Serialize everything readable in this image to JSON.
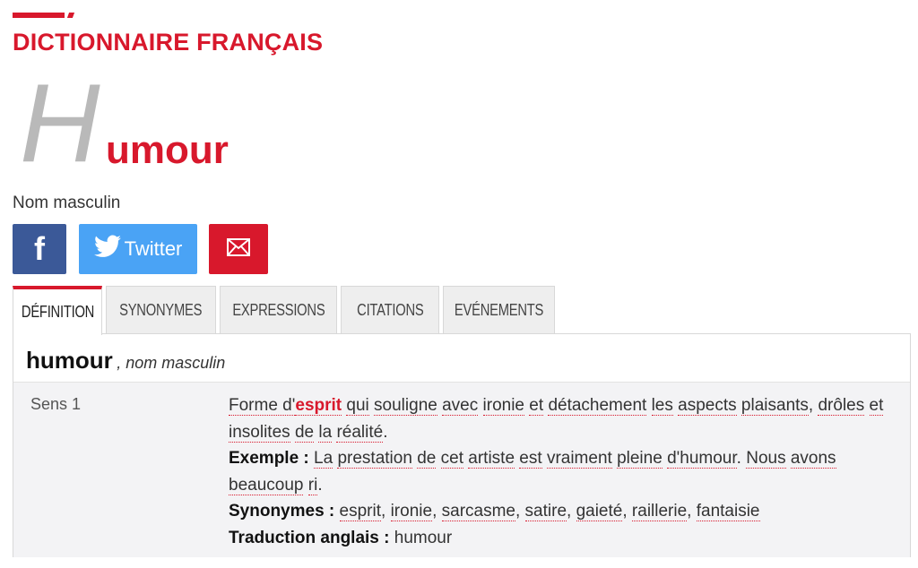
{
  "site": {
    "title": "DICTIONNAIRE FRANÇAIS"
  },
  "headword": {
    "first_letter": "H",
    "rest": "umour"
  },
  "grammar": "Nom masculin",
  "share": {
    "facebook_icon": "facebook-icon",
    "twitter_label": "Twitter",
    "twitter_icon": "twitter-bird-icon",
    "email_icon": "envelope-icon",
    "colors": {
      "facebook": "#3b5998",
      "twitter": "#4aa3f5",
      "email": "#d8182c"
    }
  },
  "tabs": [
    {
      "label": "DÉFINITION",
      "active": true
    },
    {
      "label": "SYNONYMES",
      "active": false
    },
    {
      "label": "EXPRESSIONS",
      "active": false
    },
    {
      "label": "CITATIONS",
      "active": false
    },
    {
      "label": "EVÉNEMENTS",
      "active": false
    }
  ],
  "entry": {
    "word": "humour",
    "pos": ", nom masculin"
  },
  "sense": {
    "label": "Sens 1",
    "definition": {
      "before": "Forme d'",
      "highlight": "esprit",
      "words_line": [
        "qui",
        "souligne",
        "avec",
        "ironie",
        "et",
        "détachement",
        "les",
        "aspects",
        "plaisants,",
        "drôles",
        "et",
        "insolites",
        "de",
        "la",
        "réalité."
      ]
    },
    "example_label": "Exemple :",
    "example_text": "La prestation de cet artiste est vraiment pleine d'humour. Nous avons beaucoup ri.",
    "synonyms_label": "Synonymes :",
    "synonyms": [
      "esprit",
      "ironie",
      "sarcasme",
      "satire",
      "gaieté",
      "raillerie",
      "fantaisie"
    ],
    "translation_label": "Traduction anglais :",
    "translation": "humour"
  },
  "accent_color": "#d8182c"
}
